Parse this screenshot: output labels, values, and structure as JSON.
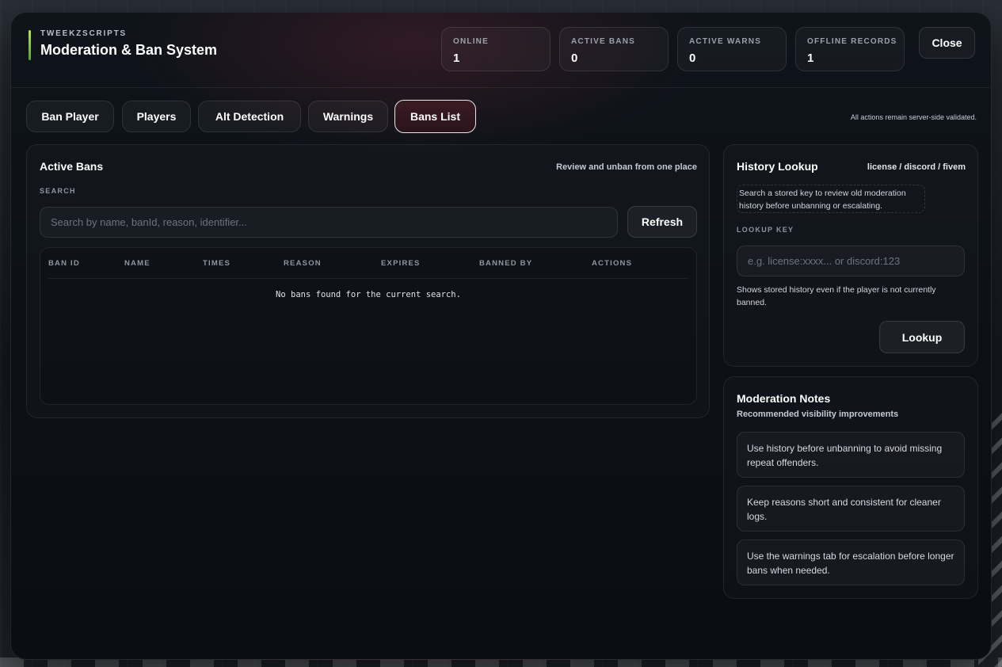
{
  "header": {
    "brand_sub": "TWEEKZSCRIPTS",
    "title": "Moderation & Ban System",
    "close_label": "Close"
  },
  "stats": [
    {
      "label": "ONLINE",
      "value": "1"
    },
    {
      "label": "ACTIVE BANS",
      "value": "0"
    },
    {
      "label": "ACTIVE WARNS",
      "value": "0"
    },
    {
      "label": "OFFLINE RECORDS",
      "value": "1"
    }
  ],
  "tabs": [
    {
      "label": "Ban Player"
    },
    {
      "label": "Players"
    },
    {
      "label": "Alt Detection"
    },
    {
      "label": "Warnings"
    },
    {
      "label": "Bans List"
    }
  ],
  "active_tab": "Bans List",
  "server_note": "All actions remain server-side validated.",
  "active_bans": {
    "title": "Active Bans",
    "subtitle": "Review and unban from one place",
    "search_label": "SEARCH",
    "search_placeholder": "Search by name, banId, reason, identifier...",
    "refresh_label": "Refresh",
    "columns": [
      "BAN ID",
      "NAME",
      "TIMES",
      "REASON",
      "EXPIRES",
      "BANNED BY",
      "ACTIONS"
    ],
    "empty_message": "No bans found for the current search."
  },
  "history_lookup": {
    "title": "History Lookup",
    "key_types": "license / discord / fivem",
    "hint": "Search a stored key to review old moderation history before unbanning or escalating.",
    "key_label": "LOOKUP KEY",
    "key_placeholder": "e.g. license:xxxx... or discord:123",
    "description": "Shows stored history even if the player is not currently banned.",
    "lookup_label": "Lookup"
  },
  "moderation_notes": {
    "title": "Moderation Notes",
    "subtitle": "Recommended visibility improvements",
    "notes": [
      "Use history before unbanning to avoid missing repeat offenders.",
      "Keep reasons short and consistent for cleaner logs.",
      "Use the warnings tab for escalation before longer bans when needed."
    ]
  },
  "colors": {
    "accent_brand": "#b9e35a",
    "active_tab_bg": "#3a1b24",
    "panel_bg": "#0a0d13"
  }
}
